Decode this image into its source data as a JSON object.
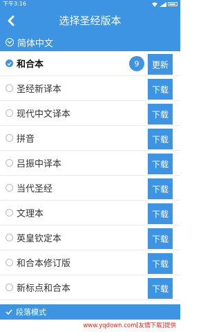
{
  "status_bar": {
    "time": "下午3:16"
  },
  "header": {
    "title": "选择圣经版本",
    "back_icon": "chevron-left-icon"
  },
  "section": {
    "label": "简体中文"
  },
  "versions": [
    {
      "name": "和合本",
      "selected": true,
      "action": "更新",
      "count": "9"
    },
    {
      "name": "圣经新译本",
      "selected": false,
      "action": "下载"
    },
    {
      "name": "现代中文译本",
      "selected": false,
      "action": "下载"
    },
    {
      "name": "拼音",
      "selected": false,
      "action": "下载"
    },
    {
      "name": "吕振中译本",
      "selected": false,
      "action": "下载"
    },
    {
      "name": "当代圣经",
      "selected": false,
      "action": "下载"
    },
    {
      "name": "文理本",
      "selected": false,
      "action": "下载"
    },
    {
      "name": "英皇钦定本",
      "selected": false,
      "action": "下载"
    },
    {
      "name": "和合本修订版",
      "selected": false,
      "action": "下载"
    },
    {
      "name": "新标点和合本",
      "selected": false,
      "action": "下载"
    }
  ],
  "bottom": {
    "mode_label": "段落模式"
  },
  "footer": {
    "watermark": "www.yqdown.com[友情下载]提供"
  },
  "colors": {
    "accent": "#3c94e2",
    "watermark": "#e8231c"
  }
}
